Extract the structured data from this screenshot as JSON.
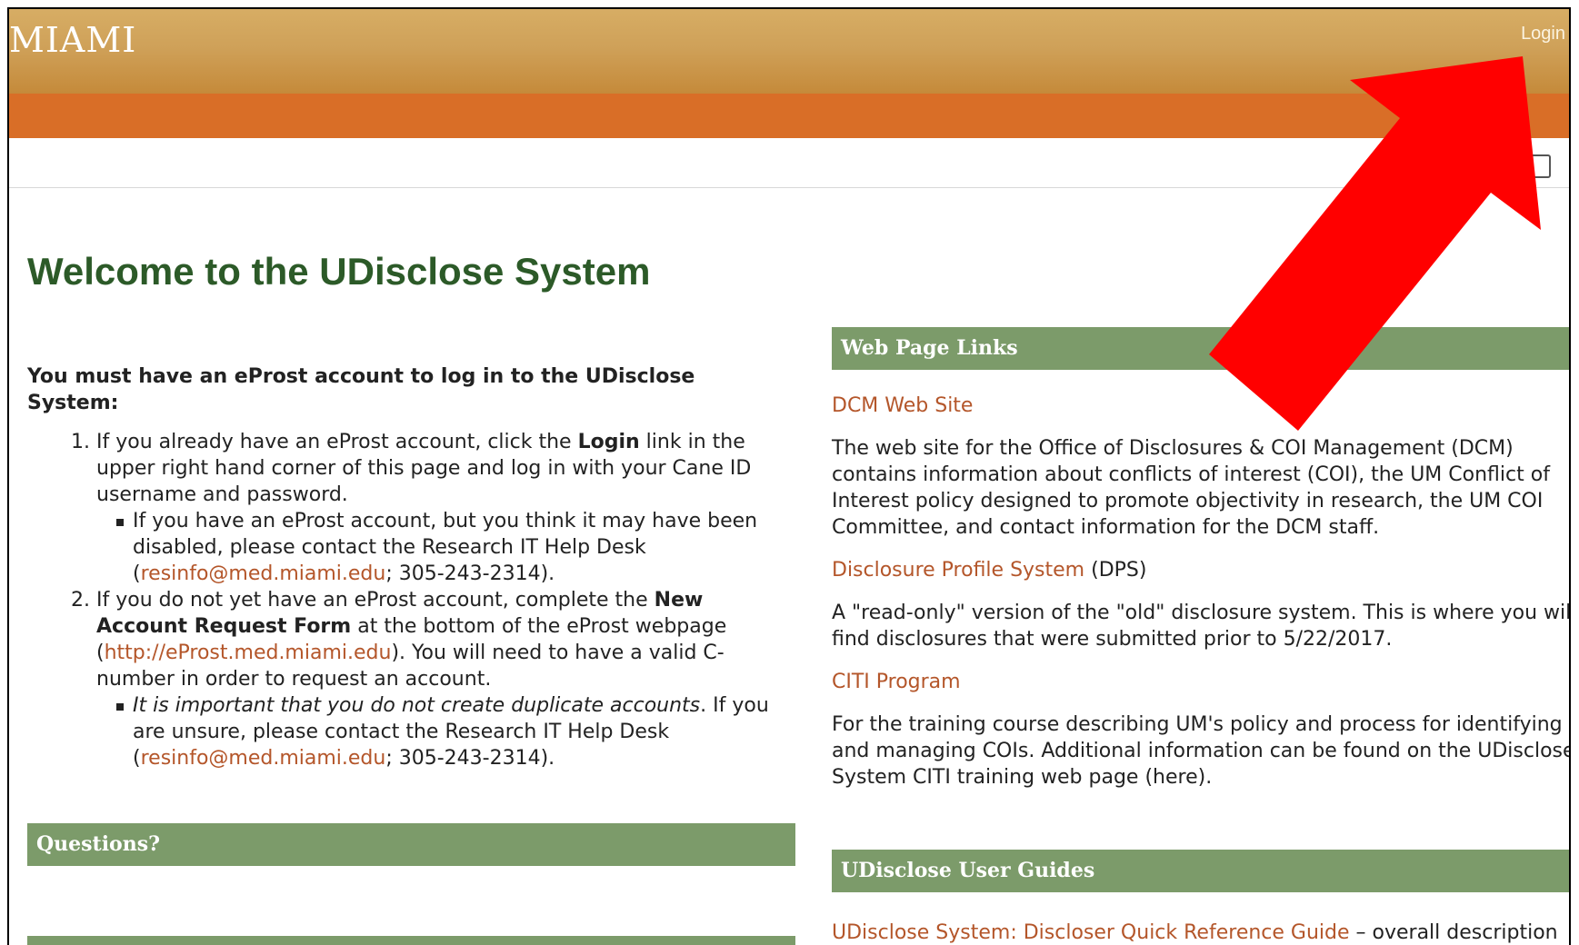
{
  "header": {
    "brand": "MIAMI",
    "login_label": "Login"
  },
  "page": {
    "title": "Welcome to the UDisclose System"
  },
  "intro": {
    "lead": "You must have an eProst account to log in to the UDisclose System:",
    "step1": {
      "pre": "If you already have an eProst account, click the ",
      "bold": "Login",
      "post": " link in the upper right hand corner of this page and log in with your Cane ID username and password.",
      "sub_pre": "If you have an eProst account, but you think it may have been disabled, please contact the Research IT Help Desk (",
      "sub_email": "resinfo@med.miami.edu",
      "sub_post": "; 305-243-2314)."
    },
    "step2": {
      "pre": "If you do not yet have an eProst account, complete the ",
      "bold": "New Account Request Form",
      "mid": " at the bottom of the eProst webpage (",
      "url": "http://eProst.med.miami.edu",
      "post": "). You will need to have a valid C-number in order to request an account.",
      "sub_italic": "It is important that you do not create duplicate accounts",
      "sub_pre": ". If you are unsure, please contact the Research IT Help Desk (",
      "sub_email": "resinfo@med.miami.edu",
      "sub_post": "; 305-243-2314)."
    }
  },
  "questions": {
    "heading": "Questions?"
  },
  "web_links": {
    "heading": "Web Page Links",
    "dcm_title": "DCM Web Site",
    "dcm_desc": "The web site for the Office of Disclosures & COI Management (DCM) contains information about conflicts of interest (COI), the UM Conflict of Interest policy designed to promote objectivity in research, the UM COI Committee, and contact information for the DCM staff.",
    "dps_title": "Disclosure Profile System",
    "dps_suffix": " (DPS)",
    "dps_desc": "A \"read-only\" version of the \"old\" disclosure system. This is where you will find disclosures that were submitted prior to 5/22/2017.",
    "citi_title": "CITI Program",
    "citi_desc": "For the training course describing UM's policy and process for identifying and managing COIs. Additional information can be found on the UDisclose System CITI training web page (here)."
  },
  "user_guides": {
    "heading": "UDisclose User Guides",
    "guide1_title": "UDisclose System: Discloser Quick Reference Guide",
    "guide1_desc": " – overall description"
  },
  "colors": {
    "accent_green": "#2c5a28",
    "section_green": "#7c9b6a",
    "orange": "#d96e27",
    "gold": "#cfa159",
    "link": "#b4562a",
    "annotation_arrow": "#ff0000"
  }
}
